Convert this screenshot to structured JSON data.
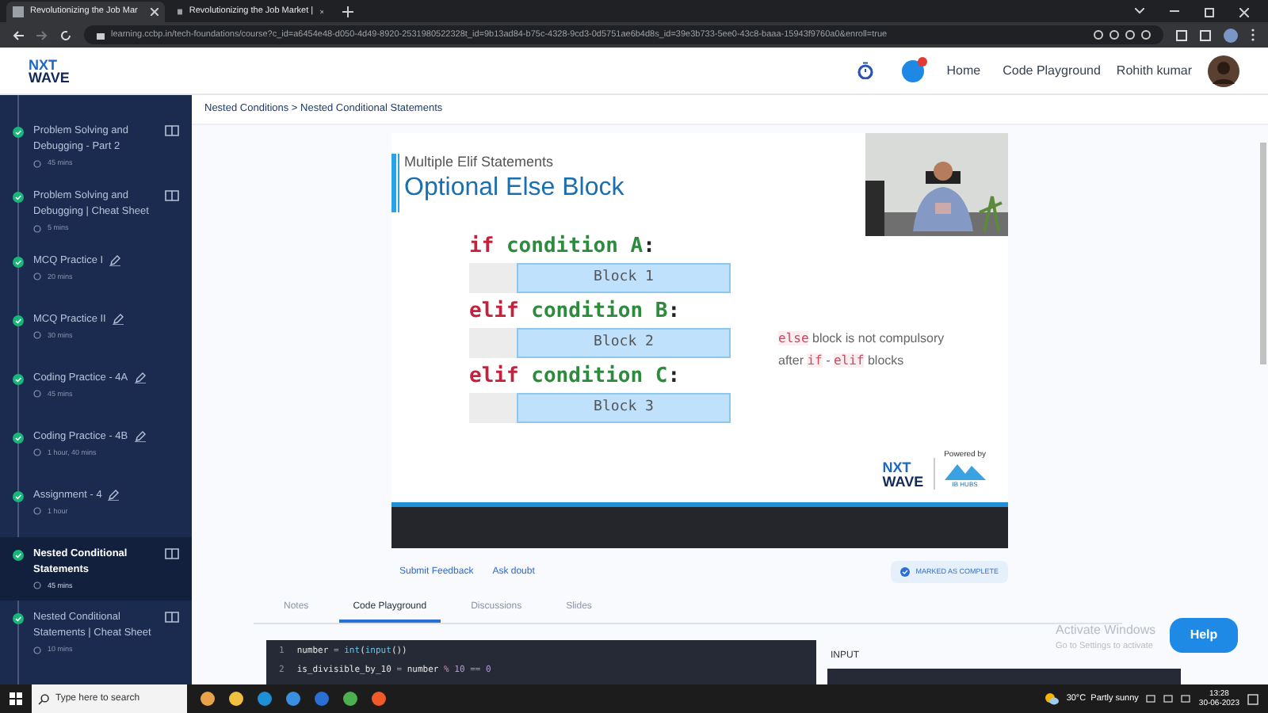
{
  "browser": {
    "tabs": [
      {
        "title": "Revolutionizing the Job Mar",
        "selected": true
      },
      {
        "title": "Revolutionizing the Job Market |",
        "selected": false
      }
    ],
    "url": "learning.ccbp.in/tech-foundations/course?c_id=a6454e48-d050-4d49-8920-2531980522328t_id=9b13ad84-b75c-4328-9cd3-0d5751ae6b4d8s_id=39e3b733-5ee0-43c8-baaa-15943f9760a0&enroll=true"
  },
  "header": {
    "logo": [
      "NXT",
      "WAVE"
    ],
    "nav": [
      "Home",
      "Code Playground"
    ],
    "user": "Rohith kumar"
  },
  "sidebar": {
    "items": [
      {
        "title": "Problem Solving and Debugging - Part 2",
        "duration": "45 mins",
        "kind": "reading",
        "selected": false
      },
      {
        "title": "Problem Solving and Debugging | Cheat Sheet",
        "duration": "5 mins",
        "kind": "reading",
        "selected": false
      },
      {
        "title": "MCQ Practice I",
        "duration": "20 mins",
        "kind": "practice",
        "selected": false
      },
      {
        "title": "MCQ Practice II",
        "duration": "30 mins",
        "kind": "practice",
        "selected": false
      },
      {
        "title": "Coding Practice - 4A",
        "duration": "45 mins",
        "kind": "practice",
        "selected": false
      },
      {
        "title": "Coding Practice - 4B",
        "duration": "1 hour, 40 mins",
        "kind": "practice",
        "selected": false
      },
      {
        "title": "Assignment - 4",
        "duration": "1 hour",
        "kind": "practice",
        "selected": false
      },
      {
        "title": "Nested Conditional Statements",
        "duration": "45 mins",
        "kind": "reading",
        "selected": true
      },
      {
        "title": "Nested Conditional Statements | Cheat Sheet",
        "duration": "10 mins",
        "kind": "reading",
        "selected": false
      }
    ]
  },
  "breadcrumb": "Nested Conditions > Nested Conditional Statements",
  "slide": {
    "subtitle": "Multiple Elif Statements",
    "title": "Optional Else Block",
    "code": [
      {
        "keyword": "if",
        "condition": "condition A",
        "colon": ":",
        "block": "Block 1"
      },
      {
        "keyword": "elif",
        "condition": "condition B",
        "colon": ":",
        "block": "Block 2"
      },
      {
        "keyword": "elif",
        "condition": "condition C",
        "colon": ":",
        "block": "Block 3"
      }
    ],
    "note": [
      [
        {
          "text": "else",
          "kind": "code"
        },
        {
          "text": " block is not compulsory",
          "kind": "plain"
        }
      ],
      [
        {
          "text": "after ",
          "kind": "plain"
        },
        {
          "text": "if",
          "kind": "code"
        },
        {
          "text": " - ",
          "kind": "plain"
        },
        {
          "text": "elif",
          "kind": "code"
        },
        {
          "text": " blocks",
          "kind": "plain"
        }
      ]
    ],
    "brand": [
      "NXT",
      "WAVE"
    ],
    "powered_by": "Powered by",
    "partner": "IB HUBS"
  },
  "actions": [
    "Submit Feedback",
    "Ask doubt"
  ],
  "complete_button": "MARKED AS COMPLETE",
  "tabs": [
    {
      "label": "Notes",
      "selected": false
    },
    {
      "label": "Code Playground",
      "selected": true
    },
    {
      "label": "Discussions",
      "selected": false
    },
    {
      "label": "Slides",
      "selected": false
    }
  ],
  "editor": {
    "lines": [
      {
        "number": "1",
        "tokens": [
          {
            "text": "number",
            "kind": "name"
          },
          {
            "text": " = ",
            "kind": "operator"
          },
          {
            "text": "int",
            "kind": "function"
          },
          {
            "text": "(",
            "kind": "name"
          },
          {
            "text": "input",
            "kind": "function"
          },
          {
            "text": "())",
            "kind": "name"
          }
        ]
      },
      {
        "number": "2",
        "tokens": [
          {
            "text": "is_divisible_by_10",
            "kind": "name"
          },
          {
            "text": " = ",
            "kind": "operator"
          },
          {
            "text": "number",
            "kind": "name"
          },
          {
            "text": " % ",
            "kind": "operator"
          },
          {
            "text": "10",
            "kind": "number"
          },
          {
            "text": " == ",
            "kind": "operator"
          },
          {
            "text": "0",
            "kind": "number"
          }
        ]
      }
    ]
  },
  "input_label": "INPUT",
  "overlay": {
    "title": "Activate Windows",
    "hint": "Go to Settings to activate"
  },
  "help": "Help",
  "taskbar": {
    "search": "Type here to search",
    "weather": "30°C  Partly sunny",
    "time": "13:28",
    "date": "30-06-2023"
  }
}
